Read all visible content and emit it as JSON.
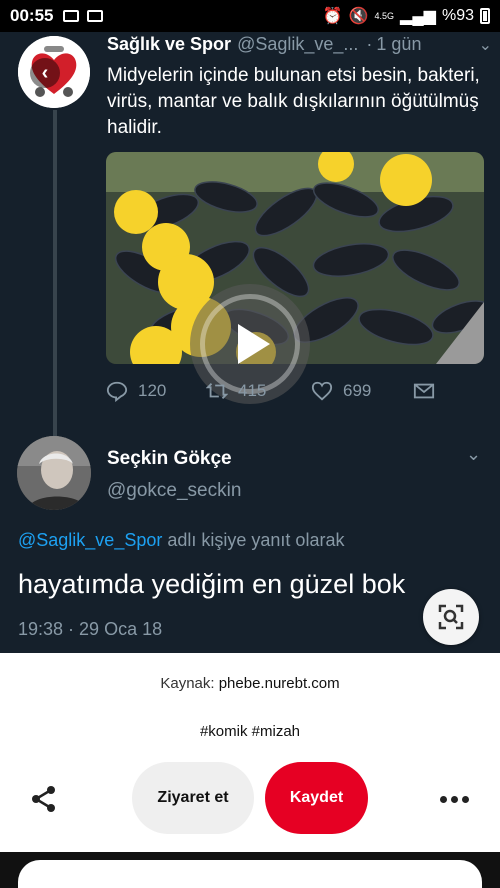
{
  "status_bar": {
    "time": "00:55",
    "network": "4.5G",
    "battery": "%93"
  },
  "tweet1": {
    "name": "Sağlık ve Spor",
    "handle": "@Saglik_ve_...",
    "separator": "·",
    "time": "1 gün",
    "text": "Midyelerin içinde bulunan etsi besin, bakteri, virüs, mantar ve balık dışkılarının öğütülmüş halidir.",
    "replies": "120",
    "retweets": "415",
    "likes": "699"
  },
  "tweet2": {
    "name": "Seçkin Gökçe",
    "handle": "@gokce_seckin",
    "reply_mention": "@Saglik_ve_Spor",
    "reply_suffix": "adlı kişiye yanıt olarak",
    "text": "hayatımda yediğim en güzel bok",
    "timestamp": "19:38 · 29 Oca 18"
  },
  "pin": {
    "source_label": "Kaynak:",
    "source_domain": "phebe.nurebt.com",
    "tags": "#komik #mizah",
    "visit_label": "Ziyaret et",
    "save_label": "Kaydet"
  },
  "colors": {
    "tweet_bg": "#15202b",
    "mention": "#1da1f2",
    "save_button": "#e60023"
  }
}
